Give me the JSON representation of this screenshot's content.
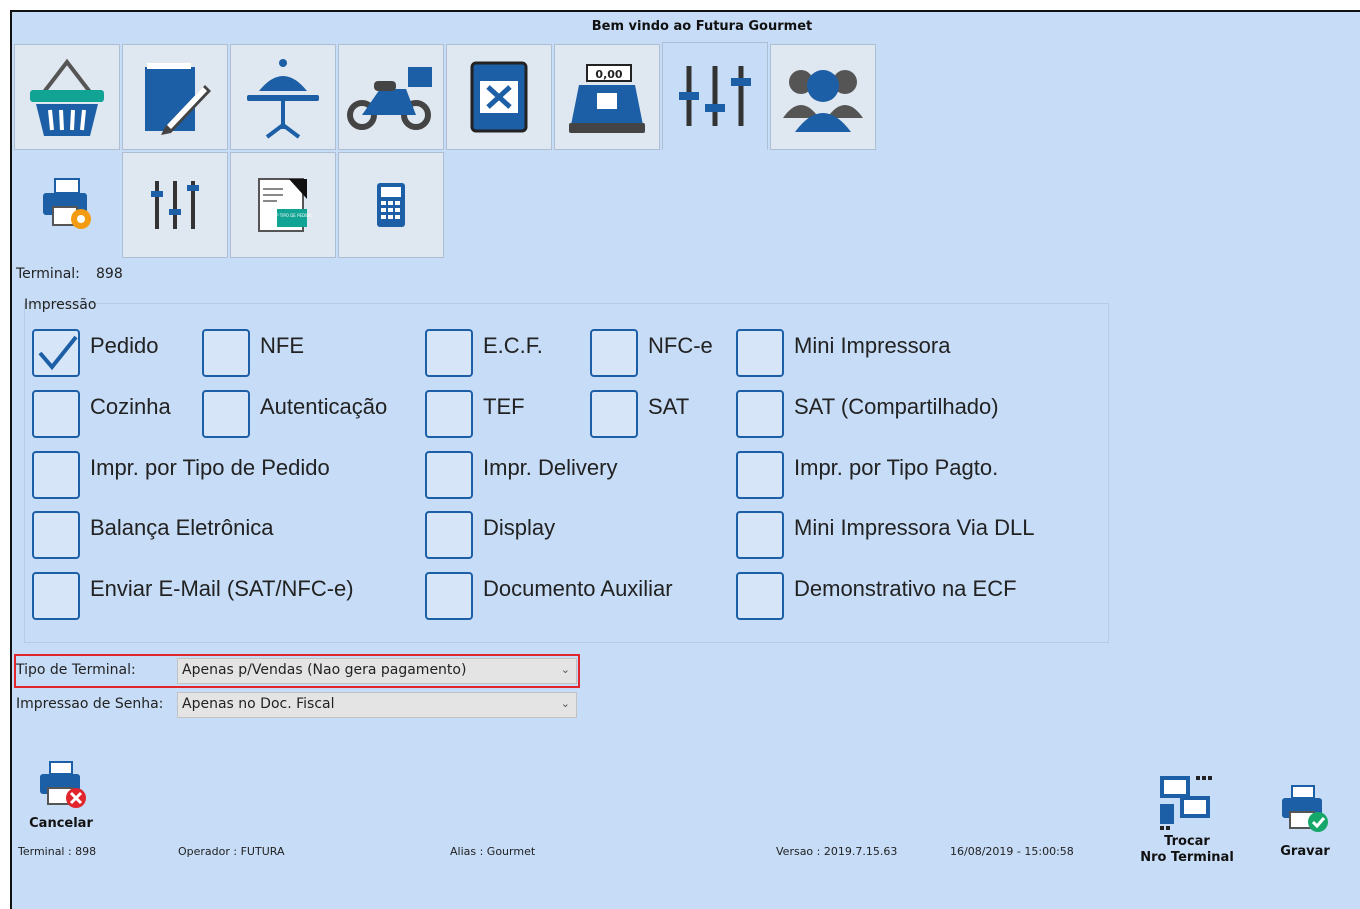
{
  "window": {
    "title": "Bem vindo ao Futura Gourmet"
  },
  "top_tabs": [
    {
      "icon": "basket-icon"
    },
    {
      "icon": "notepad-pencil-icon"
    },
    {
      "icon": "serving-table-icon"
    },
    {
      "icon": "motorcycle-delivery-icon"
    },
    {
      "icon": "menu-book-icon"
    },
    {
      "icon": "cash-register-icon",
      "display": "0,00"
    },
    {
      "icon": "sliders-icon"
    },
    {
      "icon": "users-icon"
    }
  ],
  "sub_tabs": [
    {
      "icon": "printer-settings-icon"
    },
    {
      "icon": "sliders-icon"
    },
    {
      "icon": "order-type-print-icon",
      "badge": "IMP TIPO DE PEDIDO"
    },
    {
      "icon": "calculator-icon"
    }
  ],
  "terminal_label": "Terminal:",
  "terminal_value": "898",
  "group_title": "Impressão",
  "checkboxes": [
    {
      "label": "Pedido",
      "checked": true
    },
    {
      "label": "NFE",
      "checked": false
    },
    {
      "label": "E.C.F.",
      "checked": false
    },
    {
      "label": "NFC-e",
      "checked": false
    },
    {
      "label": "Mini Impressora",
      "checked": false
    },
    {
      "label": "Cozinha",
      "checked": false
    },
    {
      "label": "Autenticação",
      "checked": false
    },
    {
      "label": "TEF",
      "checked": false
    },
    {
      "label": "SAT",
      "checked": false
    },
    {
      "label": "SAT (Compartilhado)",
      "checked": false
    },
    {
      "label": "Impr. por Tipo de Pedido",
      "checked": false
    },
    {
      "label": "Impr. Delivery",
      "checked": false
    },
    {
      "label": "Impr. por Tipo Pagto.",
      "checked": false
    },
    {
      "label": "Balança Eletrônica",
      "checked": false
    },
    {
      "label": "Display",
      "checked": false
    },
    {
      "label": "Mini Impressora Via DLL",
      "checked": false
    },
    {
      "label": "Enviar E-Mail (SAT/NFC-e)",
      "checked": false
    },
    {
      "label": "Documento Auxiliar",
      "checked": false
    },
    {
      "label": "Demonstrativo na ECF",
      "checked": false
    }
  ],
  "fields": {
    "tipo_terminal": {
      "label": "Tipo de Terminal:",
      "value": "Apenas p/Vendas (Nao gera pagamento)"
    },
    "impressao_senha": {
      "label": "Impressao de Senha:",
      "value": "Apenas no Doc. Fiscal"
    }
  },
  "buttons": {
    "cancelar": "Cancelar",
    "trocar_line1": "Trocar",
    "trocar_line2": "Nro Terminal",
    "gravar": "Gravar"
  },
  "status": {
    "terminal": "Terminal : 898",
    "operador": "Operador : FUTURA",
    "alias": "Alias : Gourmet",
    "versao": "Versao : 2019.7.15.63",
    "datetime": "16/08/2019 - 15:00:58"
  },
  "colors": {
    "background": "#c7dcf6",
    "checkbox_border": "#1c5fa6",
    "icon_blue": "#1c5fa6",
    "highlight": "#e0262c"
  }
}
